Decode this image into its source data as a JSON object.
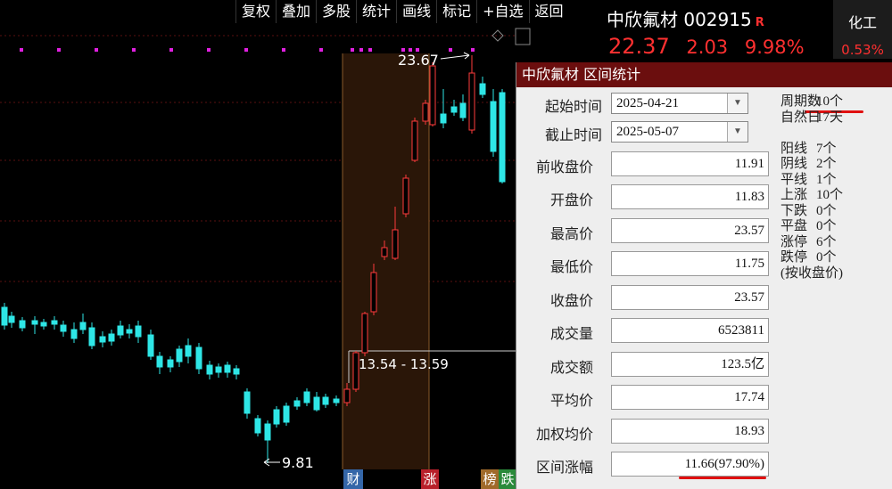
{
  "toolbar": [
    "复权",
    "叠加",
    "多股",
    "统计",
    "画线",
    "标记",
    "+自选",
    "返回"
  ],
  "stock": {
    "name": "中欣氟材",
    "code": "002915",
    "r_badge": "R",
    "price": "22.37",
    "change": "2.03",
    "change_pct": "9.98%"
  },
  "industry": {
    "name": "化工",
    "change_pct": "0.53%"
  },
  "colors": {
    "up": "#ff3b3b",
    "down": "#2ee6e6",
    "panel_title_bg": "#6b0e0e",
    "highlight_bg": "#2a1608",
    "marker": "#e020e0"
  },
  "chart": {
    "high_label": "23.67",
    "low_label": "9.81",
    "range_label": "13.54 - 13.59",
    "tags": [
      "财",
      "涨",
      "榜",
      "跌"
    ]
  },
  "panel": {
    "title": "中欣氟材 区间统计",
    "start_label": "起始时间",
    "start_date": "2025-04-21",
    "end_label": "截止时间",
    "end_date": "2025-05-07",
    "fields": [
      {
        "label": "前收盘价",
        "value": "11.91"
      },
      {
        "label": "开盘价",
        "value": "11.83"
      },
      {
        "label": "最高价",
        "value": "23.57"
      },
      {
        "label": "最低价",
        "value": "11.75"
      },
      {
        "label": "收盘价",
        "value": "23.57"
      },
      {
        "label": "成交量",
        "value": "6523811"
      },
      {
        "label": "成交额",
        "value": "123.5亿"
      },
      {
        "label": "平均价",
        "value": "17.74"
      },
      {
        "label": "加权均价",
        "value": "18.93"
      },
      {
        "label": "区间涨幅",
        "value": "11.66(97.90%)"
      }
    ],
    "stats": [
      {
        "k": "周期数",
        "v": "10个"
      },
      {
        "k": "自然日",
        "v": "17天"
      },
      {
        "k": "",
        "v": ""
      },
      {
        "k": "阳线",
        "v": "7个"
      },
      {
        "k": "阴线",
        "v": "2个"
      },
      {
        "k": "平线",
        "v": "1个"
      },
      {
        "k": "上涨",
        "v": "10个"
      },
      {
        "k": "下跌",
        "v": "0个"
      },
      {
        "k": "平盘",
        "v": "0个"
      },
      {
        "k": "涨停",
        "v": "6个"
      },
      {
        "k": "跌停",
        "v": "0个"
      },
      {
        "k": "(按收盘价)",
        "v": ""
      }
    ]
  }
}
